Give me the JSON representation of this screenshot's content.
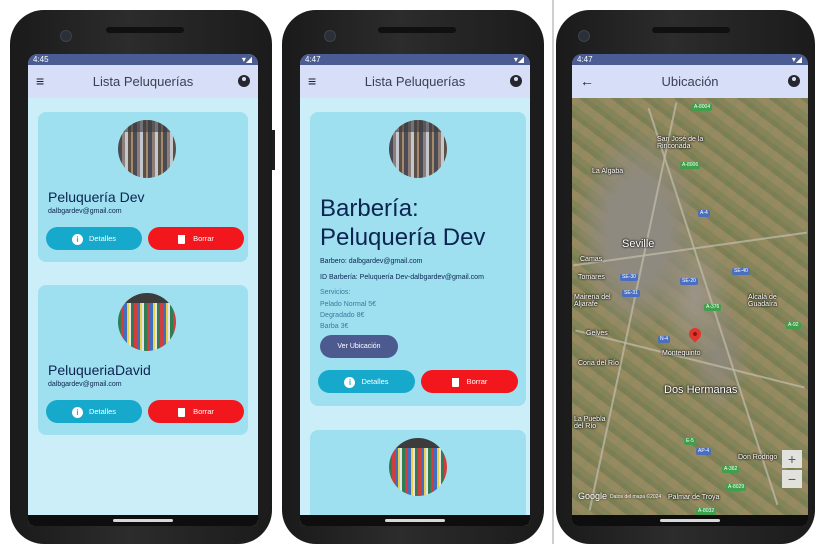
{
  "status": {
    "time_left": "4:45",
    "time_middle": "4:47",
    "time_right": "4:47",
    "icons": "▾◢"
  },
  "list_screen": {
    "title": "Lista Peluquerías",
    "cards": [
      {
        "name": "Peluquería Dev",
        "email": "dalbgardev@gmail.com",
        "details_label": "Detalles",
        "delete_label": "Borrar",
        "avatar": "clothing-rack-image"
      },
      {
        "name": "PeluqueriaDavid",
        "email": "dalbgardev@gmail.com",
        "details_label": "Detalles",
        "delete_label": "Borrar",
        "avatar": "shop-shelves-image"
      }
    ]
  },
  "detail_screen": {
    "title": "Lista Peluquerías",
    "heading": "Barbería: Peluquería Dev",
    "barbero": "Barbero: dalbgardev@gmail.com",
    "id_barberia": "ID Barbería: Peluquería Dev-dalbgardev@gmail.com",
    "services_title": "Servicios:",
    "services": [
      "Pelado Normal 5€",
      "Degradado 8€",
      "Barba 3€"
    ],
    "location_button": "Ver Ubicación",
    "details_label": "Detalles",
    "delete_label": "Borrar"
  },
  "map_screen": {
    "title": "Ubicación",
    "labels": {
      "seville": "Seville",
      "dos_hermanas": "Dos Hermanas",
      "alcala": "Alcalá de Guadaíra",
      "camas": "Camas",
      "aljarafe": "Mairena del Aljarafe",
      "gelves": "Gelves",
      "tomares": "Tomares",
      "la_rinconada": "San José de la Rinconada",
      "coria": "Coria del Río",
      "puebla": "La Puebla del Río",
      "montequinto": "Montequinto",
      "palmar": "Palmar de Troya",
      "algaba": "La Algaba",
      "utrera": "Don Rodrigo"
    },
    "roads": [
      "A-8004",
      "A-8006",
      "A-4",
      "SE-30",
      "SE-20",
      "SE-40",
      "A-376",
      "SE-31",
      "A-92",
      "N-4",
      "E-5",
      "AP-4",
      "A-8029",
      "A-362",
      "A-8032"
    ],
    "zoom_in": "+",
    "zoom_out": "−",
    "google": "Google",
    "map_data": "Datos del mapa ©2024"
  },
  "colors": {
    "appbar": "#d7def7",
    "statusbar": "#4a5c93",
    "card": "#9ee0ef",
    "details": "#16a9cc",
    "delete": "#f2161d",
    "text": "#0d2350"
  }
}
